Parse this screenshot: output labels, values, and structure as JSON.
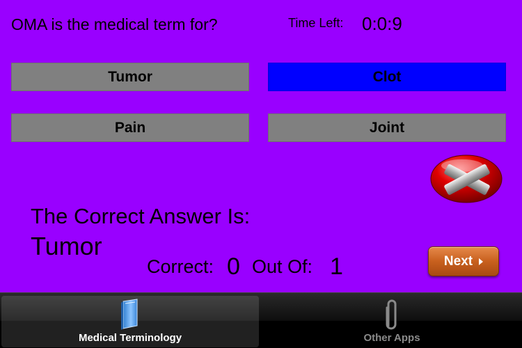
{
  "quiz": {
    "question": "OMA is the medical term for?",
    "time_left_label": "Time Left:",
    "time_left_value": "0:0:9",
    "answers": [
      {
        "label": "Tumor",
        "selected": false
      },
      {
        "label": "Clot",
        "selected": true
      },
      {
        "label": "Pain",
        "selected": false
      },
      {
        "label": "Joint",
        "selected": false
      }
    ],
    "result_icon": "wrong-x-icon",
    "correct_answer_caption": "The Correct Answer Is:",
    "correct_answer": "Tumor",
    "score": {
      "correct_label": "Correct:",
      "correct_value": "0",
      "out_of_label": "Out Of:",
      "out_of_value": "1"
    },
    "next_label": "Next"
  },
  "colors": {
    "background": "#9900ff",
    "answer_default": "#808080",
    "answer_selected": "#0000ff",
    "next_button": "#c8601e"
  },
  "tabbar": {
    "tabs": [
      {
        "label": "Medical Terminology",
        "icon": "book-icon",
        "active": true
      },
      {
        "label": "Other Apps",
        "icon": "paperclip-icon",
        "active": false
      }
    ]
  }
}
